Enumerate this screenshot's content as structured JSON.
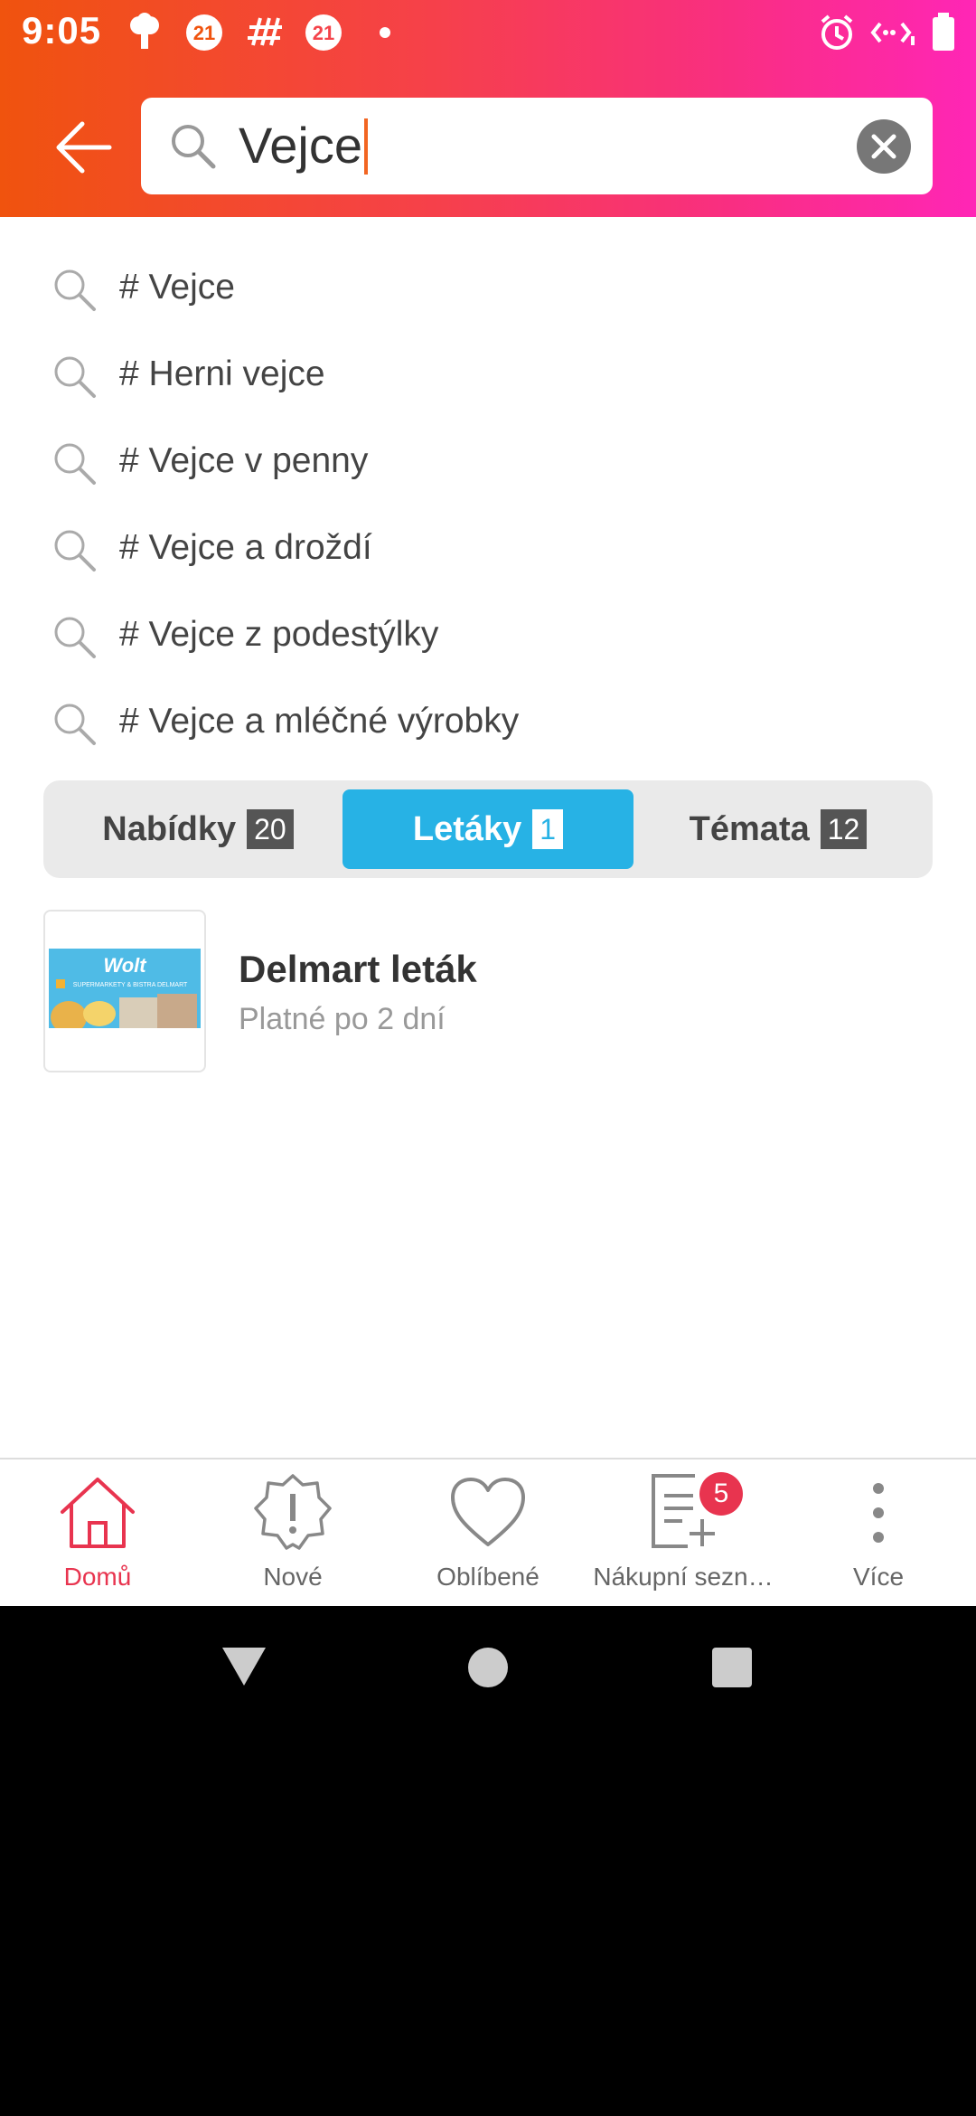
{
  "status_bar": {
    "time": "9:05",
    "notif_badge_1": "21",
    "notif_badge_2": "21",
    "icons": [
      "cloud-icon",
      "badge-21-icon",
      "hashtag-icon",
      "badge-21-icon",
      "dot-icon",
      "alarm-icon",
      "data-icon",
      "battery-icon"
    ]
  },
  "search": {
    "value": "Vejce",
    "back_icon": "arrow-left-icon",
    "clear_icon": "close-circle-icon"
  },
  "suggestions": [
    {
      "label": "# Vejce"
    },
    {
      "label": "# Herni vejce"
    },
    {
      "label": "# Vejce v penny"
    },
    {
      "label": "# Vejce a droždí"
    },
    {
      "label": "# Vejce z podestýlky"
    },
    {
      "label": "# Vejce a mléčné výrobky"
    }
  ],
  "tabs": [
    {
      "label": "Nabídky",
      "count": "20",
      "active": false
    },
    {
      "label": "Letáky",
      "count": "1",
      "active": true
    },
    {
      "label": "Témata",
      "count": "12",
      "active": false
    }
  ],
  "results": [
    {
      "title": "Delmart leták",
      "subtitle": "Platné po 2 dní",
      "thumb_brand": "Wolt",
      "thumb_caption": "SUPERMARKETY & BISTRA DELMART"
    }
  ],
  "bottom_nav": [
    {
      "label": "Domů",
      "icon": "home-icon",
      "active": true
    },
    {
      "label": "Nové",
      "icon": "new-badge-icon",
      "active": false
    },
    {
      "label": "Oblíbené",
      "icon": "heart-icon",
      "active": false
    },
    {
      "label": "Nákupní sezn…",
      "icon": "shopping-list-icon",
      "active": false,
      "badge": "5"
    },
    {
      "label": "Více",
      "icon": "more-vertical-icon",
      "active": false
    }
  ],
  "colors": {
    "header_gradient_start": "#f0530e",
    "header_gradient_end": "#ff26b6",
    "active_tab": "#27b2e5",
    "nav_active": "#e8344f"
  }
}
